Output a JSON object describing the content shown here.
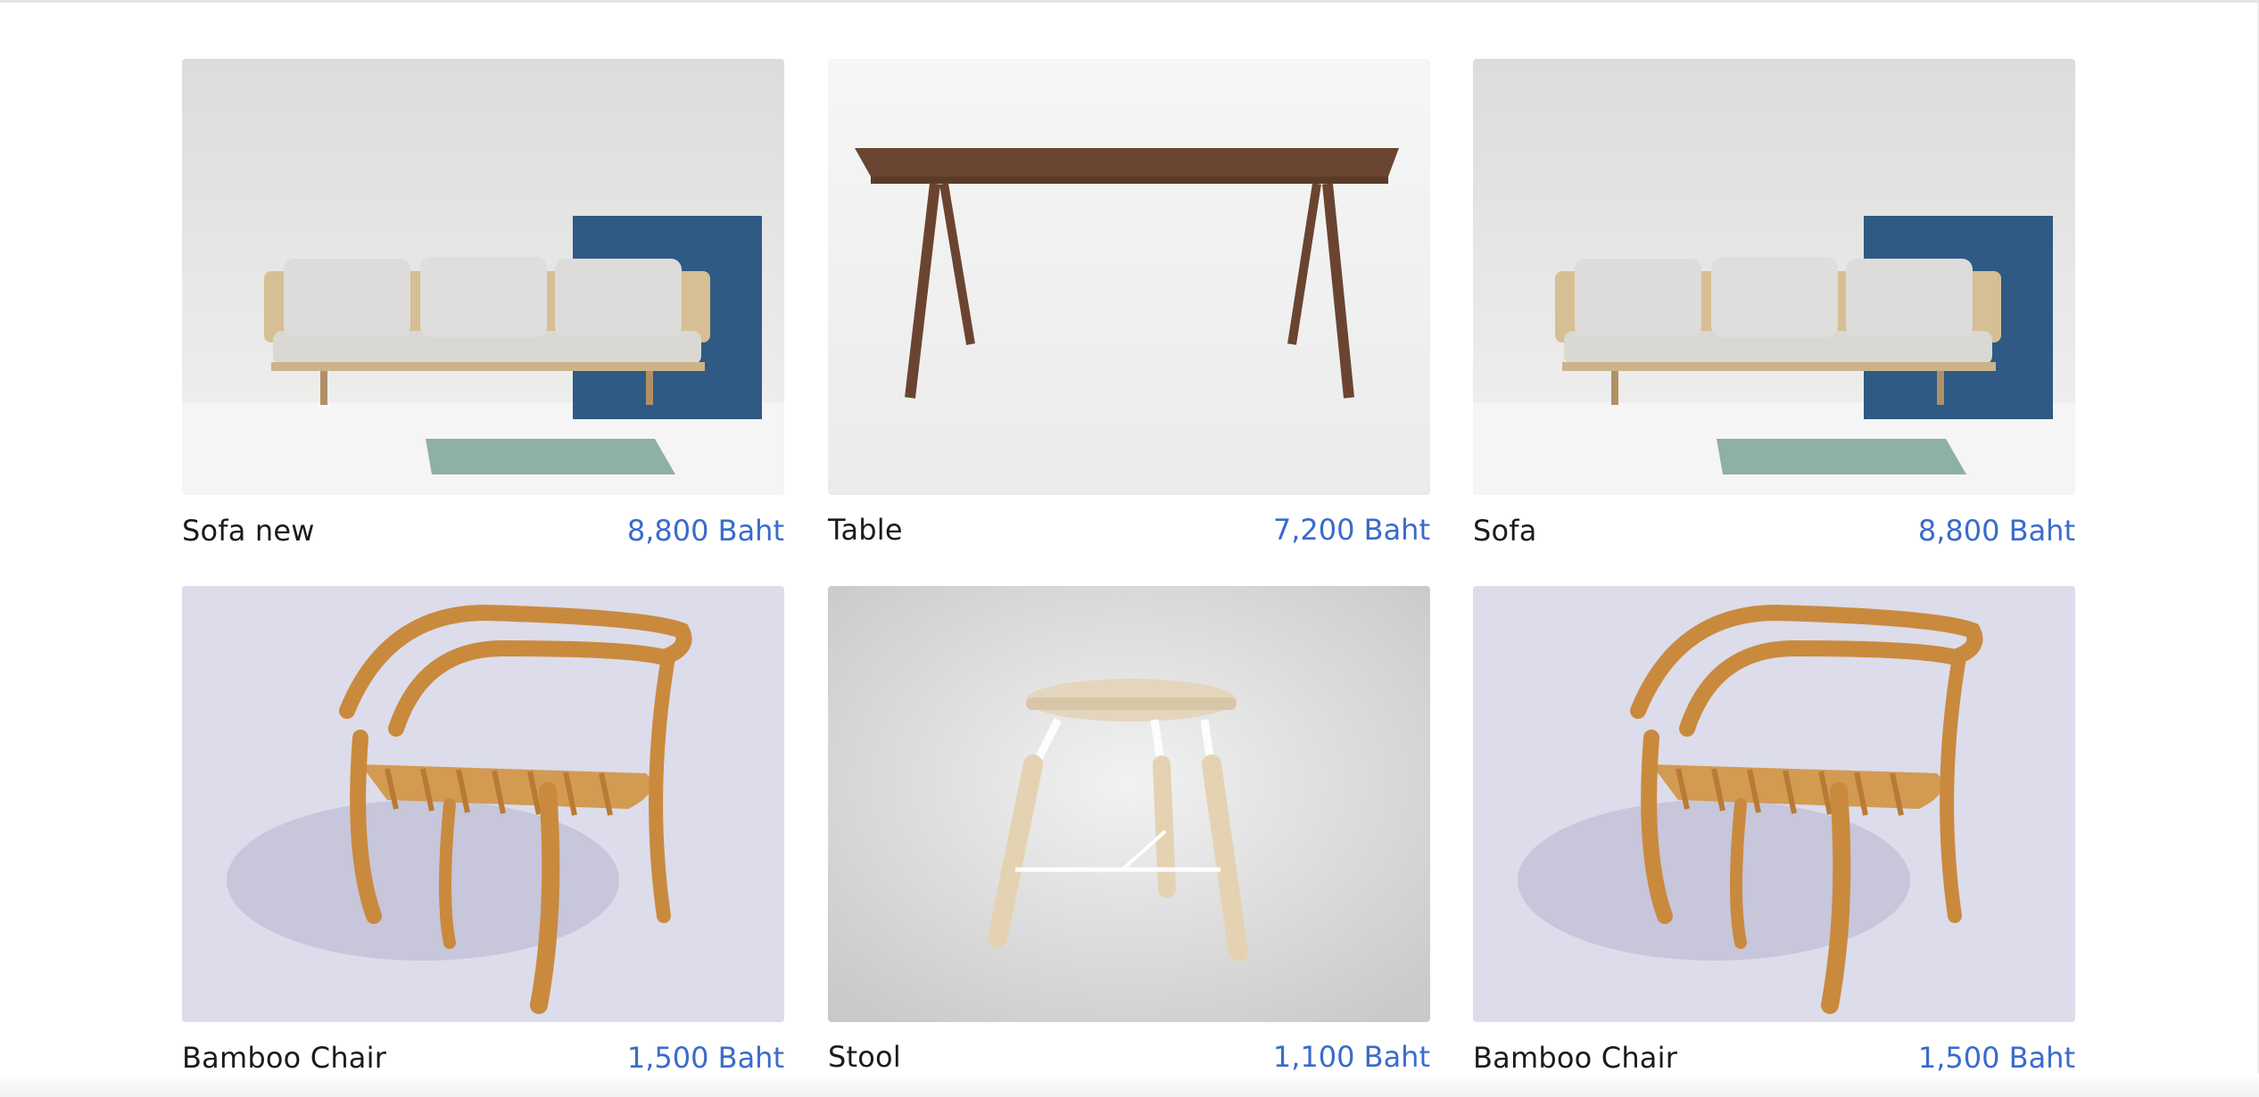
{
  "products": [
    {
      "name": "Sofa new",
      "price": "8,800 Baht",
      "image": "sofa-photo"
    },
    {
      "name": "Table",
      "price": "7,200 Baht",
      "image": "table-photo"
    },
    {
      "name": "Sofa",
      "price": "8,800 Baht",
      "image": "sofa-photo"
    },
    {
      "name": "Bamboo Chair",
      "price": "1,500 Baht",
      "image": "bamboo-chair-photo"
    },
    {
      "name": "Stool",
      "price": "1,100 Baht",
      "image": "stool-photo"
    },
    {
      "name": "Bamboo Chair",
      "price": "1,500 Baht",
      "image": "bamboo-chair-photo"
    }
  ],
  "colors": {
    "price": "#3a6bcc",
    "name": "#1b1b1b"
  }
}
